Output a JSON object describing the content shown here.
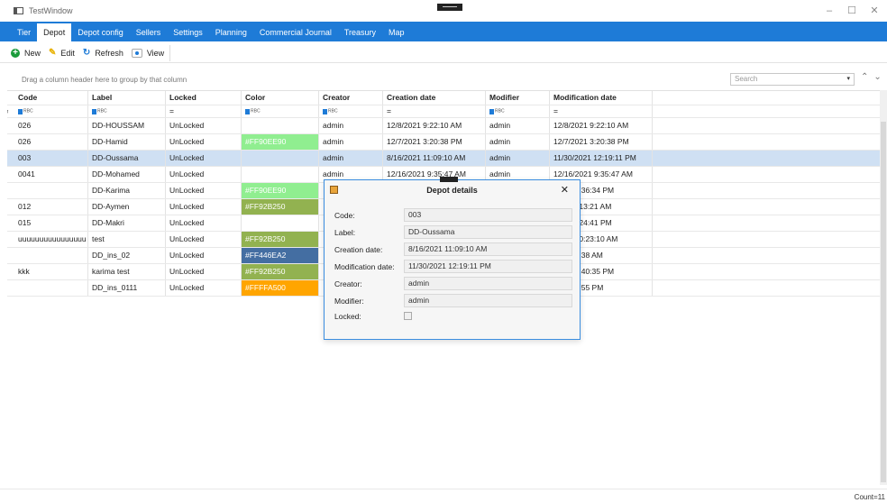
{
  "window": {
    "title": "TestWindow",
    "minimize": "–",
    "maximize": "☐",
    "close": "✕"
  },
  "tabs": [
    {
      "label": "Tier"
    },
    {
      "label": "Depot"
    },
    {
      "label": "Depot config"
    },
    {
      "label": "Sellers"
    },
    {
      "label": "Settings"
    },
    {
      "label": "Planning"
    },
    {
      "label": "Commercial Journal"
    },
    {
      "label": "Treasury"
    },
    {
      "label": "Map"
    }
  ],
  "toolbar": {
    "new_label": "New",
    "edit_label": "Edit",
    "refresh_label": "Refresh",
    "view_label": "View",
    "edit_icon": "✎",
    "refresh_icon": "↻"
  },
  "group_panel": {
    "hint": "Drag a column header here to group by that column"
  },
  "search": {
    "placeholder": "Search",
    "dropdown": "▾"
  },
  "nav": {
    "up": "⌃",
    "down": "⌄"
  },
  "columns": {
    "code": "Code",
    "label": "Label",
    "locked": "Locked",
    "color": "Color",
    "creator": "Creator",
    "creation_date": "Creation date",
    "modifier": "Modifier",
    "modification_date": "Modification date"
  },
  "filters": {
    "text": "RBC",
    "eq": "="
  },
  "rows": [
    {
      "code": "026",
      "label": "DD-HOUSSAM",
      "locked": "UnLocked",
      "color": "",
      "color_hex": "",
      "creator": "admin",
      "creation_date": "12/8/2021 9:22:10 AM",
      "modifier": "admin",
      "modification_date": "12/8/2021 9:22:10 AM"
    },
    {
      "code": "026",
      "label": "DD-Hamid",
      "locked": "UnLocked",
      "color": "#FF90EE90",
      "color_hex": "#90EE90",
      "creator": "admin",
      "creation_date": "12/7/2021 3:20:38 PM",
      "modifier": "admin",
      "modification_date": "12/7/2021 3:20:38 PM"
    },
    {
      "code": "003",
      "label": "DD-Oussama",
      "locked": "UnLocked",
      "color": "",
      "color_hex": "",
      "creator": "admin",
      "creation_date": "8/16/2021 11:09:10 AM",
      "modifier": "admin",
      "modification_date": "11/30/2021 12:19:11 PM"
    },
    {
      "code": "0041",
      "label": "DD-Mohamed",
      "locked": "UnLocked",
      "color": "",
      "color_hex": "",
      "creator": "admin",
      "creation_date": "12/16/2021 9:35:47 AM",
      "modifier": "admin",
      "modification_date": "12/16/2021 9:35:47 AM"
    },
    {
      "code": "",
      "label": "DD-Karima",
      "locked": "UnLocked",
      "color": "#FF90EE90",
      "color_hex": "#90EE90",
      "creator": "",
      "creation_date": "",
      "modifier": "",
      "modification_date": "/2021 3:36:34 PM"
    },
    {
      "code": "012",
      "label": "DD-Aymen",
      "locked": "UnLocked",
      "color": "#FF92B250",
      "color_hex": "#92B250",
      "creator": "",
      "creation_date": "",
      "modifier": "",
      "modification_date": "2021 9:13:21 AM"
    },
    {
      "code": "015",
      "label": "DD-Makri",
      "locked": "UnLocked",
      "color": "",
      "color_hex": "",
      "creator": "",
      "creation_date": "",
      "modifier": "",
      "modification_date": "2021 2:24:41 PM"
    },
    {
      "code": "uuuuuuuuuuuuuuuu",
      "label": "test",
      "locked": "UnLocked",
      "color": "#FF92B250",
      "color_hex": "#92B250",
      "creator": "",
      "creation_date": "",
      "modifier": "",
      "modification_date": "/2021 10:23:10 AM"
    },
    {
      "code": "",
      "label": "DD_ins_02",
      "locked": "UnLocked",
      "color": "#FF446EA2",
      "color_hex": "#446EA2",
      "creator": "",
      "creation_date": "",
      "modifier": "",
      "modification_date": "22 9:18:38 AM"
    },
    {
      "code": "kkk",
      "label": "karima test",
      "locked": "UnLocked",
      "color": "#FF92B250",
      "color_hex": "#92B250",
      "creator": "",
      "creation_date": "",
      "modifier": "",
      "modification_date": "/2021 2:40:35 PM"
    },
    {
      "code": "",
      "label": "DD_ins_0111",
      "locked": "UnLocked",
      "color": "#FFFFA500",
      "color_hex": "#FFA500",
      "creator": "",
      "creation_date": "",
      "modifier": "",
      "modification_date": "22 1:39:55 PM"
    }
  ],
  "selected_row_index": 2,
  "status": {
    "count": "Count=11"
  },
  "dialog": {
    "title": "Depot details",
    "close": "✕",
    "fields": [
      {
        "label": "Code:",
        "value": "003"
      },
      {
        "label": "Label:",
        "value": "DD-Oussama"
      },
      {
        "label": "Creation date:",
        "value": "8/16/2021 11:09:10 AM"
      },
      {
        "label": "Modification date:",
        "value": "11/30/2021 12:19:11 PM"
      },
      {
        "label": "Creator:",
        "value": "admin"
      },
      {
        "label": "Modifier:",
        "value": "admin"
      }
    ],
    "locked_label": "Locked:",
    "locked": false
  },
  "colors": {
    "accent": "#1E7BD7",
    "selected_row": "#CFE0F3"
  }
}
